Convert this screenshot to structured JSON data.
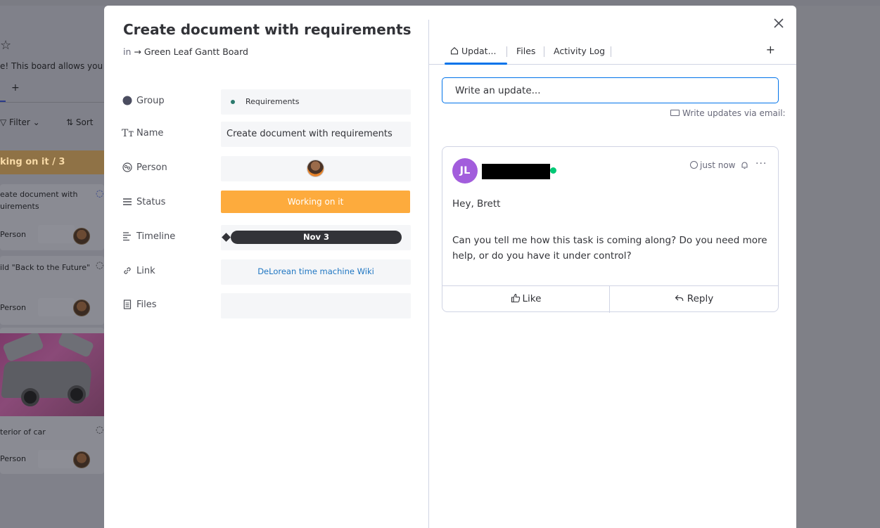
{
  "background_board": {
    "description_fragment": "e! This board allows you to",
    "add_tab": "+",
    "filter_label": "Filter",
    "sort_label": "Sort",
    "group_title": "king on it / 3",
    "cards": [
      {
        "title_line1": "eate document with",
        "title_line2": "uirements",
        "person_label": "Person"
      },
      {
        "title_line1": "ild \"Back to the Future\"",
        "title_line2": "",
        "person_label": "Person"
      },
      {
        "title_line1": "terior of car",
        "title_line2": "",
        "person_label": "Person"
      }
    ]
  },
  "item": {
    "title": "Create document with requirements",
    "breadcrumb_prefix": "in",
    "breadcrumb_arrow": "→",
    "board_name": "Green Leaf Gantt Board"
  },
  "fields": {
    "group": {
      "label": "Group",
      "value": "Requirements",
      "dot_color": "#2b7a6d"
    },
    "name": {
      "label": "Name",
      "value": "Create document with requirements"
    },
    "person": {
      "label": "Person"
    },
    "status": {
      "label": "Status",
      "value": "Working on it",
      "color": "#fdab3d"
    },
    "timeline": {
      "label": "Timeline",
      "value": "Nov 3"
    },
    "link": {
      "label": "Link",
      "value": "DeLorean time machine Wiki"
    },
    "files": {
      "label": "Files"
    }
  },
  "tabs": [
    {
      "label": "Updat...",
      "active": true
    },
    {
      "label": "Files",
      "active": false
    },
    {
      "label": "Activity Log",
      "active": false
    }
  ],
  "add_tab_label": "+",
  "update_input": {
    "placeholder": "Write an update..."
  },
  "email_link": "Write updates via email:",
  "post": {
    "avatar_initials": "JL",
    "avatar_color": "#a25ddc",
    "time": "just now",
    "greeting": "Hey, Brett",
    "body": "Can you tell me how this task is coming along? Do you need more help, or do you have it under control?",
    "like_label": "Like",
    "reply_label": "Reply"
  },
  "colors": {
    "accent": "#0073ea",
    "online": "#00c875",
    "link": "#1f76c2"
  },
  "icons": {
    "close": "close-icon",
    "home": "home-icon",
    "group": "circle-icon",
    "name": "text-icon",
    "person": "person-icon",
    "status": "status-lines-icon",
    "timeline": "timeline-icon",
    "link": "link-icon",
    "files": "file-icon",
    "email": "email-icon",
    "clock": "clock-icon",
    "bell": "bell-icon",
    "more": "more-icon",
    "like": "thumbs-up-icon",
    "reply": "reply-icon"
  }
}
